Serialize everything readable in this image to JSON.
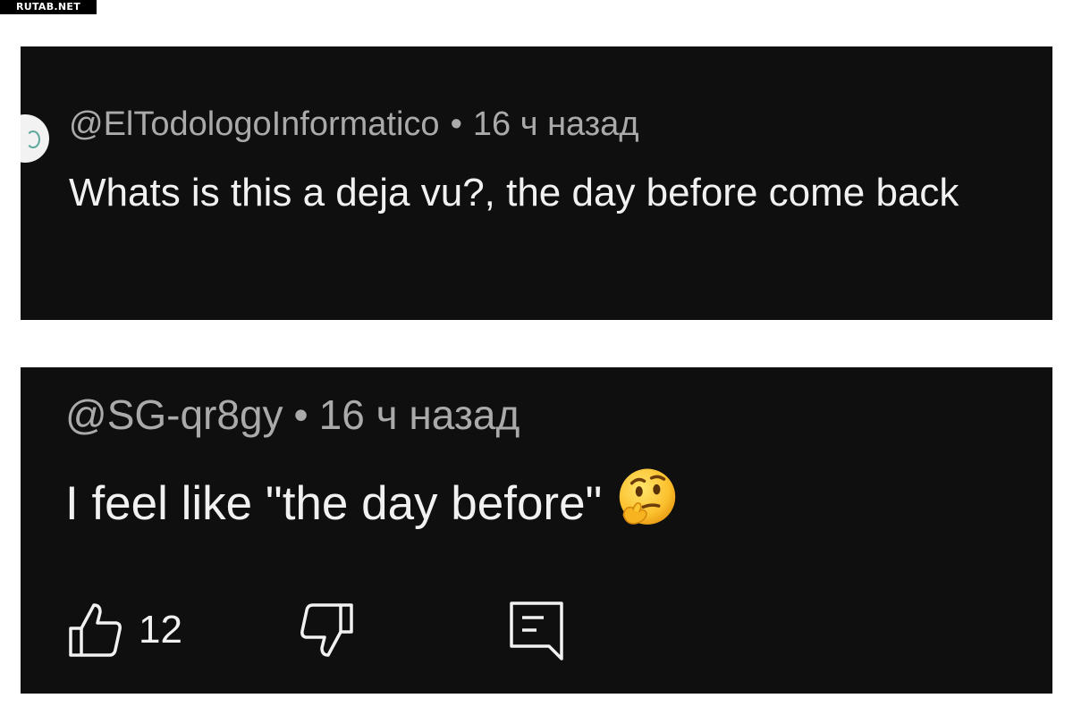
{
  "watermark": "RUTAB.NET",
  "comments": [
    {
      "author": "@ElTodologoInformatico",
      "separator": "•",
      "time": "16 ч назад",
      "text": "Whats is this a deja vu?, the day before come back"
    },
    {
      "author": "@SG-qr8gy",
      "separator": "•",
      "time": "16 ч назад",
      "text": "I feel like \"the day before\"",
      "emoji": "thinking-face-emoji",
      "likes": "12",
      "icons": {
        "like": "thumbs-up-icon",
        "dislike": "thumbs-down-icon",
        "reply": "comment-reply-icon"
      }
    }
  ],
  "colors": {
    "panel_background": "#0f0f0f",
    "meta_text": "#aaaaaa",
    "body_text": "#f1f1f1",
    "page_background": "#ffffff"
  }
}
